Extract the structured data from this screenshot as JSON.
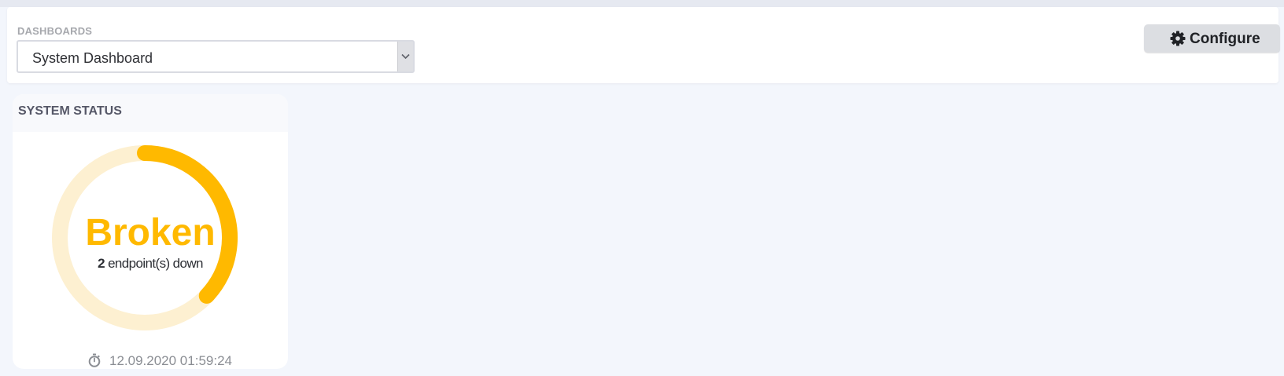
{
  "header": {
    "dashboards_label": "DASHBOARDS",
    "dashboard_select": {
      "value": "System Dashboard"
    },
    "configure_button_label": "Configure"
  },
  "system_status": {
    "title": "SYSTEM STATUS",
    "status": "Broken",
    "endpoints_down_count": "2",
    "endpoints_down_text": "endpoint(s) down",
    "timestamp": "12.09.2020 01:59:24",
    "gauge_fraction": 0.37
  },
  "colors": {
    "accent": "#ffb900",
    "gauge_track": "#fdf0d1",
    "page_bg": "#f3f6fc"
  },
  "icons": {
    "configure": "gear-icon",
    "select_arrow": "chevron-down-icon",
    "timestamp": "stopwatch-icon"
  }
}
